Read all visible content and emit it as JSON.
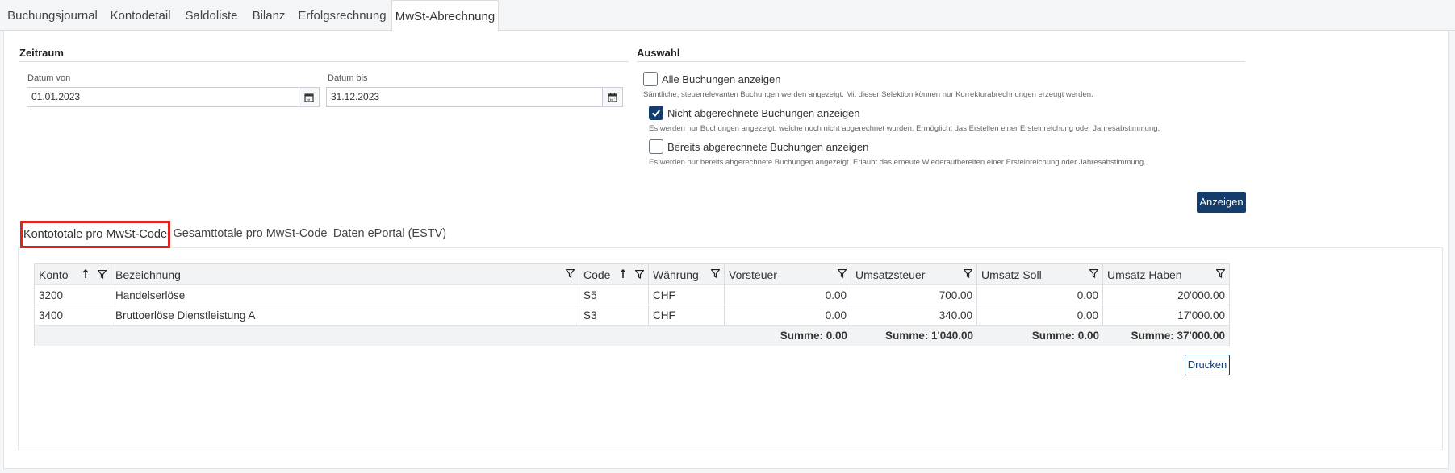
{
  "top_tabs": [
    {
      "label": "Buchungsjournal"
    },
    {
      "label": "Kontodetail"
    },
    {
      "label": "Saldoliste"
    },
    {
      "label": "Bilanz"
    },
    {
      "label": "Erfolgsrechnung"
    },
    {
      "label": "MwSt-Abrechnung",
      "active": true
    }
  ],
  "zeitraum": {
    "title": "Zeitraum",
    "from_label": "Datum von",
    "from_value": "01.01.2023",
    "to_label": "Datum bis",
    "to_value": "31.12.2023"
  },
  "auswahl": {
    "title": "Auswahl",
    "options": [
      {
        "label": "Alle Buchungen anzeigen",
        "checked": false,
        "help": "Sämtliche, steuerrelevanten Buchungen werden angezeigt. Mit dieser Selektion können nur Korrekturabrechnungen erzeugt werden."
      },
      {
        "label": "Nicht abgerechnete Buchungen anzeigen",
        "checked": true,
        "help": "Es werden nur Buchungen angezeigt, welche noch nicht abgerechnet wurden. Ermöglicht das Erstellen einer Ersteinreichung oder Jahresabstimmung."
      },
      {
        "label": "Bereits abgerechnete Buchungen anzeigen",
        "checked": false,
        "help": "Es werden nur bereits abgerechnete Buchungen angezeigt. Erlaubt das erneute Wiederaufbereiten einer Ersteinreichung oder Jahresabstimmung."
      }
    ],
    "show_button": "Anzeigen"
  },
  "sub_tabs": [
    {
      "label": "Kontototale pro MwSt-Code",
      "active": true
    },
    {
      "label": "Gesamttotale pro MwSt-Code"
    },
    {
      "label": "Daten ePortal (ESTV)"
    }
  ],
  "grid": {
    "columns": [
      "Konto",
      "Bezeichnung",
      "Code",
      "Währung",
      "Vorsteuer",
      "Umsatzsteuer",
      "Umsatz Soll",
      "Umsatz Haben"
    ],
    "rows": [
      [
        "3200",
        "Handelserlöse",
        "S5",
        "CHF",
        "0.00",
        "700.00",
        "0.00",
        "20'000.00"
      ],
      [
        "3400",
        "Bruttoerlöse Dienstleistung A",
        "S3",
        "CHF",
        "0.00",
        "340.00",
        "0.00",
        "17'000.00"
      ]
    ],
    "totals": {
      "vorsteuer": "Summe: 0.00",
      "umsatzsteuer": "Summe: 1'040.00",
      "umsatz_soll": "Summe: 0.00",
      "umsatz_haben": "Summe: 37'000.00"
    }
  },
  "print_button": "Drucken",
  "colors": {
    "accent": "#143c6c",
    "highlight": "#e3231d"
  }
}
